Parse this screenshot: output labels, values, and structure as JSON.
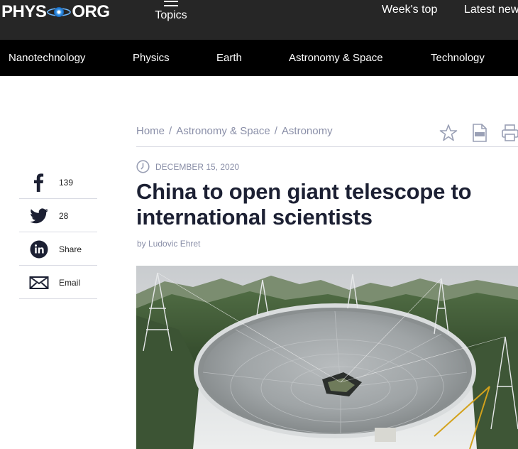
{
  "header": {
    "logo_left": "PHYS",
    "logo_right": "ORG",
    "topics_label": "Topics",
    "links": [
      "Week's top",
      "Latest new"
    ]
  },
  "categories": [
    "Nanotechnology",
    "Physics",
    "Earth",
    "Astronomy & Space",
    "Technology"
  ],
  "breadcrumb": [
    "Home",
    "Astronomy & Space",
    "Astronomy"
  ],
  "breadcrumb_sep": "/",
  "article": {
    "date": "DECEMBER 15, 2020",
    "title_line1": "China to open giant telescope to",
    "title_line2": "international scientists",
    "author": "by Ludovic Ehret"
  },
  "share": [
    {
      "icon": "facebook-icon",
      "label": "139"
    },
    {
      "icon": "twitter-icon",
      "label": "28"
    },
    {
      "icon": "linkedin-icon",
      "label": "Share"
    },
    {
      "icon": "email-icon",
      "label": "Email"
    }
  ],
  "colors": {
    "topbar": "#262626",
    "catnav": "#000000",
    "accent": "#1d7bd6",
    "muted": "#8a8fa8",
    "title": "#1c2033"
  }
}
